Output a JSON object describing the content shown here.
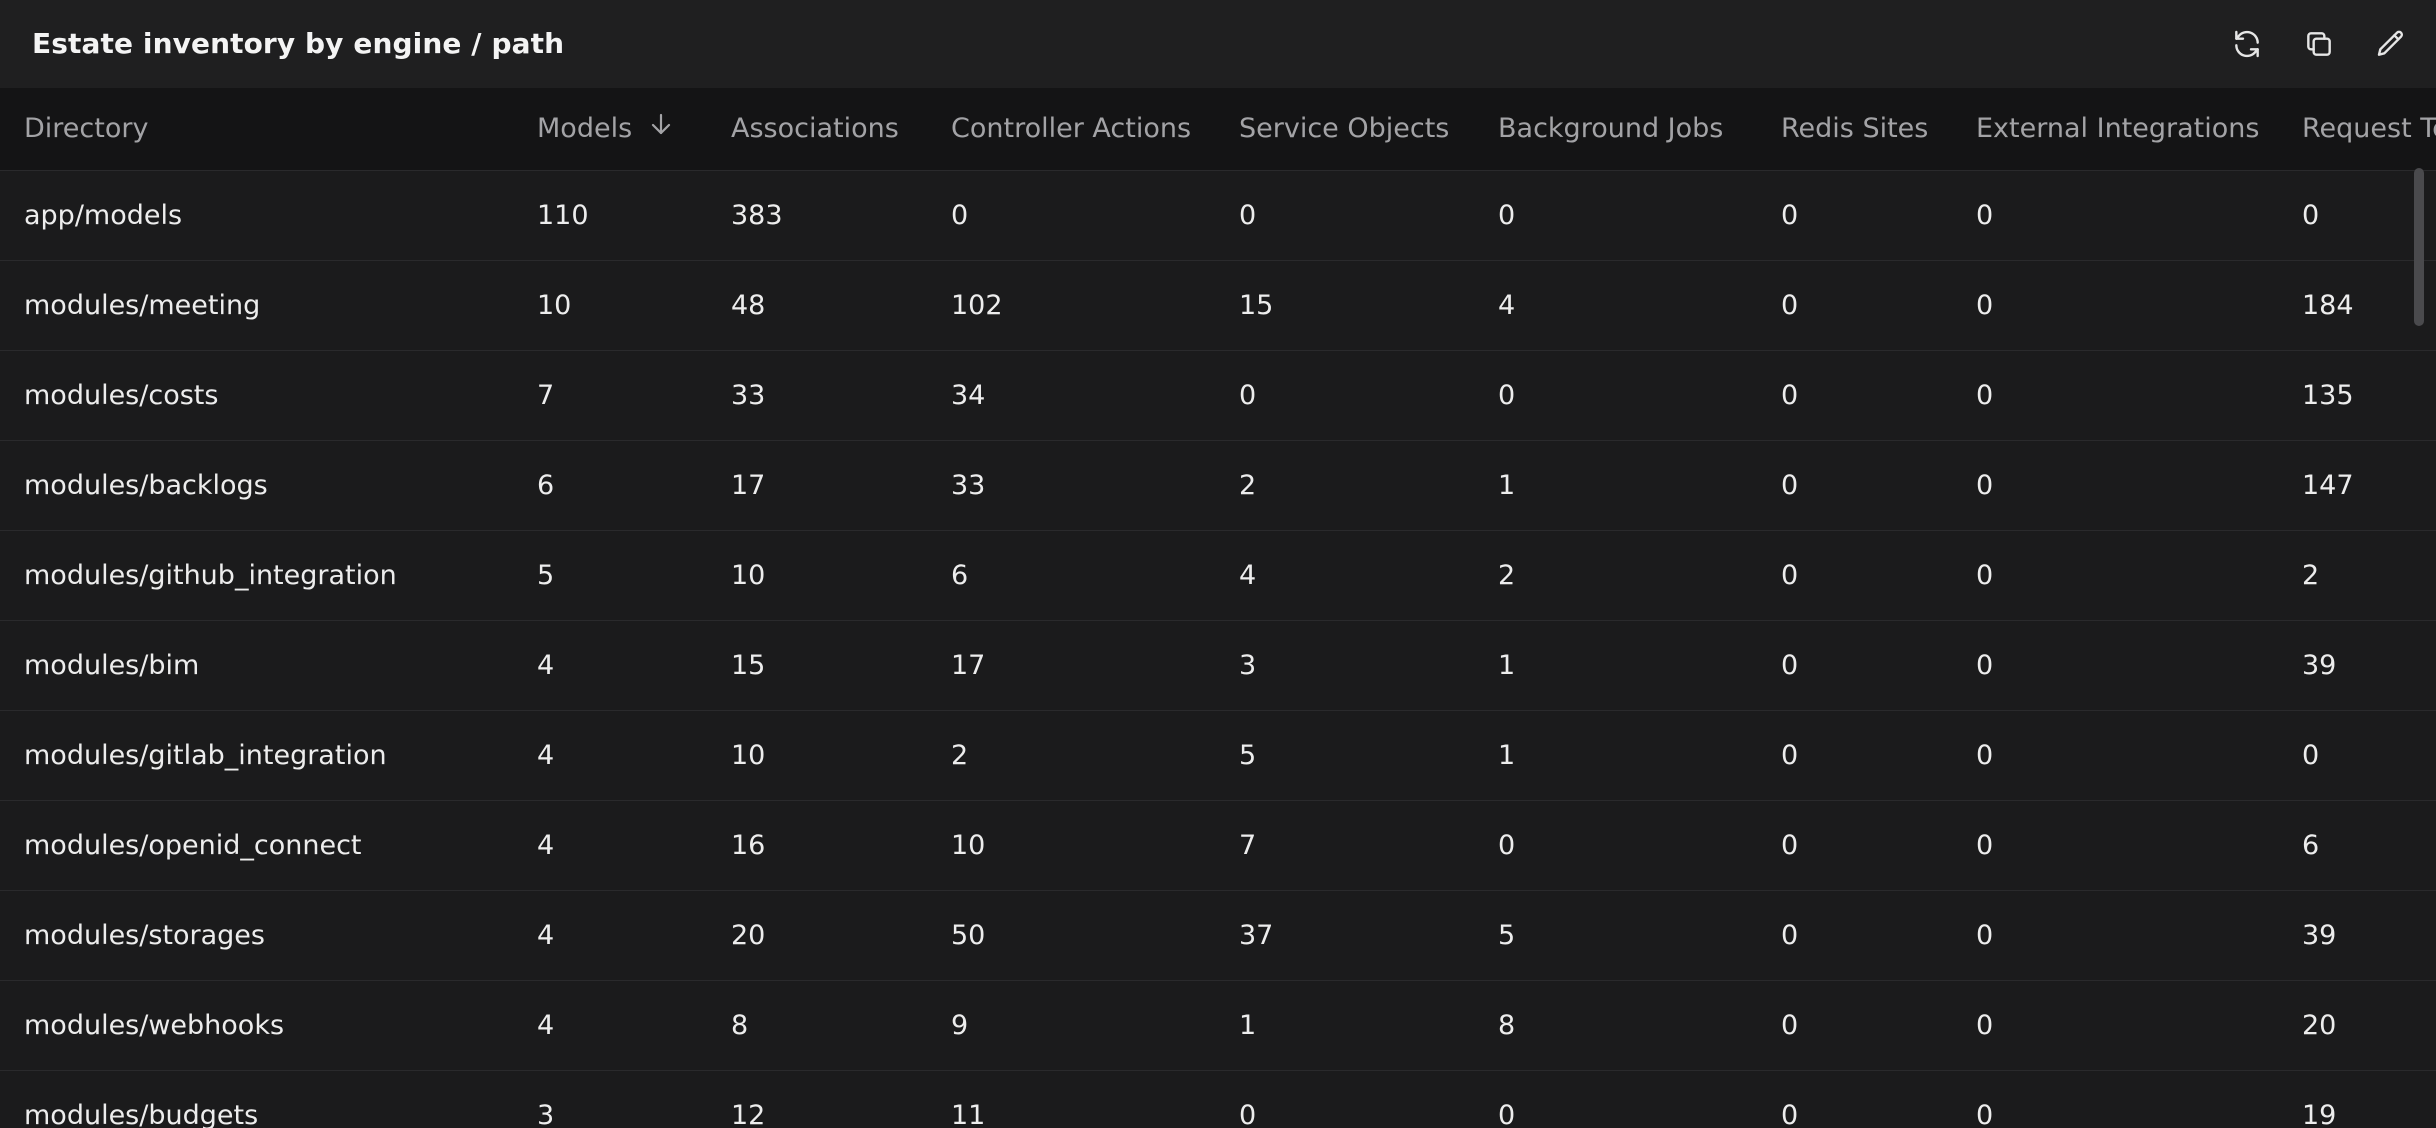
{
  "panel": {
    "title": "Estate inventory by engine / path",
    "actions": [
      {
        "name": "refresh",
        "icon": "refresh-icon"
      },
      {
        "name": "copy",
        "icon": "copy-icon"
      },
      {
        "name": "edit",
        "icon": "pencil-icon"
      }
    ]
  },
  "table": {
    "sorted_column": "Models",
    "sort_direction": "descending",
    "columns": [
      "Directory",
      "Models",
      "Associations",
      "Controller Actions",
      "Service Objects",
      "Background Jobs",
      "Redis Sites",
      "External Integrations",
      "Request Te"
    ],
    "rows": [
      [
        "app/models",
        "110",
        "383",
        "0",
        "0",
        "0",
        "0",
        "0",
        "0"
      ],
      [
        "modules/meeting",
        "10",
        "48",
        "102",
        "15",
        "4",
        "0",
        "0",
        "184"
      ],
      [
        "modules/costs",
        "7",
        "33",
        "34",
        "0",
        "0",
        "0",
        "0",
        "135"
      ],
      [
        "modules/backlogs",
        "6",
        "17",
        "33",
        "2",
        "1",
        "0",
        "0",
        "147"
      ],
      [
        "modules/github_integration",
        "5",
        "10",
        "6",
        "4",
        "2",
        "0",
        "0",
        "2"
      ],
      [
        "modules/bim",
        "4",
        "15",
        "17",
        "3",
        "1",
        "0",
        "0",
        "39"
      ],
      [
        "modules/gitlab_integration",
        "4",
        "10",
        "2",
        "5",
        "1",
        "0",
        "0",
        "0"
      ],
      [
        "modules/openid_connect",
        "4",
        "16",
        "10",
        "7",
        "0",
        "0",
        "0",
        "6"
      ],
      [
        "modules/storages",
        "4",
        "20",
        "50",
        "37",
        "5",
        "0",
        "0",
        "39"
      ],
      [
        "modules/webhooks",
        "4",
        "8",
        "9",
        "1",
        "8",
        "0",
        "0",
        "20"
      ],
      [
        "modules/budgets",
        "3",
        "12",
        "11",
        "0",
        "0",
        "0",
        "0",
        "19"
      ]
    ]
  },
  "colors": {
    "background": "#1b1b1c",
    "header_bg": "#1f1f20",
    "column_header_bg": "#141415",
    "text": "#ededed",
    "muted_text": "#a3a3a6",
    "divider": "#2a2a2c"
  }
}
